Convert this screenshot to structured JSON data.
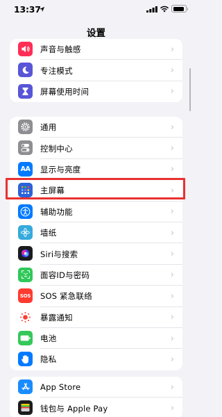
{
  "status_bar": {
    "time": "13:37",
    "icons": [
      "location-icon",
      "signal-icon",
      "wifi-icon",
      "battery-icon"
    ]
  },
  "nav": {
    "title": "设置"
  },
  "colors": {
    "background": "#f2f2f7",
    "highlight": "#e8312f",
    "sound": "#ff2d55",
    "focus": "#5856d6",
    "screen_time": "#5856d6",
    "general": "#8e8e93",
    "control_center": "#8e8e93",
    "display": "#007aff",
    "home_screen": "#2c62d9",
    "accessibility": "#007aff",
    "wallpaper": "#36aadc",
    "siri": "#1c1c1e",
    "face_id": "#30c85a",
    "sos": "#ff3b30",
    "exposure": "#ffffff",
    "battery": "#34c759",
    "privacy": "#007aff",
    "app_store": "#1a8cff",
    "wallet": "#1c1c1e"
  },
  "groups": [
    {
      "items": [
        {
          "label": "声音与触感",
          "icon": "speaker-icon"
        },
        {
          "label": "专注模式",
          "icon": "moon-icon"
        },
        {
          "label": "屏幕使用时间",
          "icon": "hourglass-icon"
        }
      ]
    },
    {
      "items": [
        {
          "label": "通用",
          "icon": "gear-icon"
        },
        {
          "label": "控制中心",
          "icon": "toggles-icon"
        },
        {
          "label": "显示与亮度",
          "icon": "aa-icon",
          "icon_text": "AA"
        },
        {
          "label": "主屏幕",
          "icon": "app-grid-icon"
        },
        {
          "label": "辅助功能",
          "icon": "accessibility-icon",
          "highlighted": true
        },
        {
          "label": "墙纸",
          "icon": "flower-icon"
        },
        {
          "label": "Siri与搜索",
          "icon": "siri-icon"
        },
        {
          "label": "面容ID与密码",
          "icon": "face-id-icon"
        },
        {
          "label": "SOS 紧急联络",
          "icon": "sos-icon",
          "icon_text": "SOS"
        },
        {
          "label": "暴露通知",
          "icon": "exposure-icon"
        },
        {
          "label": "电池",
          "icon": "battery-icon"
        },
        {
          "label": "隐私",
          "icon": "hand-icon"
        }
      ]
    },
    {
      "items": [
        {
          "label": "App Store",
          "icon": "app-store-icon"
        },
        {
          "label": "钱包与 Apple Pay",
          "icon": "wallet-icon"
        }
      ]
    }
  ]
}
